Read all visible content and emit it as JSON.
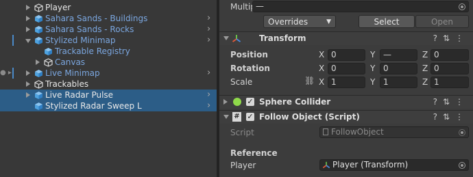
{
  "hierarchy": {
    "items": [
      {
        "label": "Player",
        "color": "white"
      },
      {
        "label": "Sahara Sands - Buildings",
        "color": "blue"
      },
      {
        "label": "Sahara Sands - Rocks",
        "color": "blue"
      },
      {
        "label": "Stylized Minimap",
        "color": "blue"
      },
      {
        "label": "Trackable Registry",
        "color": "blue"
      },
      {
        "label": "Canvas",
        "color": "blue"
      },
      {
        "label": "Live Minimap",
        "color": "blue"
      },
      {
        "label": "Trackables",
        "color": "white"
      },
      {
        "label": "Live Radar Pulse",
        "color": "white"
      },
      {
        "label": "Stylized Radar Sweep L",
        "color": "white"
      }
    ]
  },
  "inspector": {
    "multiple_label": "Multiple",
    "multiple_value": "—",
    "overrides_label": "Overrides",
    "select_label": "Select",
    "open_label": "Open",
    "transform": {
      "title": "Transform",
      "position_label": "Position",
      "rotation_label": "Rotation",
      "scale_label": "Scale",
      "axis_x": "X",
      "axis_y": "Y",
      "axis_z": "Z",
      "position": {
        "x": "0",
        "y": "—",
        "z": "0"
      },
      "rotation": {
        "x": "0",
        "y": "0",
        "z": "0"
      },
      "scale": {
        "x": "1",
        "y": "1",
        "z": "1"
      }
    },
    "sphere_collider": {
      "title": "Sphere Collider"
    },
    "follow_object": {
      "title": "Follow Object (Script)",
      "script_label": "Script",
      "script_value": "FollowObject",
      "reference_header": "Reference",
      "player_label": "Player",
      "player_value": "Player (Transform)"
    }
  },
  "colors": {
    "selection": "#2c5d87",
    "prefab_blue": "#7ba7e0",
    "cube_blue": "#4fa3e0"
  }
}
